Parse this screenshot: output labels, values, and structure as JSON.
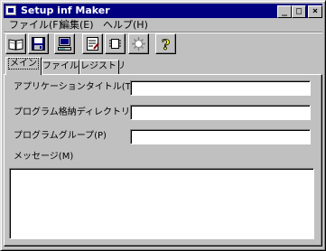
{
  "window": {
    "title": "Setup inf Maker",
    "controls": {
      "minimize": "_",
      "maximize": "□",
      "close": "×"
    }
  },
  "menu": [
    {
      "label": "ファイル(F)"
    },
    {
      "label": "編集(E)"
    },
    {
      "label": "ヘルプ(H)"
    }
  ],
  "toolbar": [
    {
      "icon": "open-book-icon"
    },
    {
      "icon": "save-disk-icon"
    },
    {
      "icon": "computer-icon"
    },
    {
      "icon": "edit-form-icon"
    },
    {
      "icon": "chip-icon"
    },
    {
      "icon": "gear-icon"
    },
    {
      "icon": "help-question-icon",
      "glyph": "?"
    }
  ],
  "tabs": [
    {
      "label": "メイン",
      "active": true
    },
    {
      "label": "ファイル",
      "active": false
    },
    {
      "label": "レジストリ",
      "active": false
    }
  ],
  "form": {
    "app_title_label": "アプリケーションタイトル(T)",
    "app_title_value": "",
    "install_dir_label": "プログラム格納ディレクトリ(D)",
    "install_dir_value": "",
    "group_label": "プログラムグループ(P)",
    "group_value": "",
    "message_label": "メッセージ(M)",
    "message_value": ""
  },
  "colors": {
    "titlebar": "#000080",
    "face": "#c0c0c0"
  }
}
